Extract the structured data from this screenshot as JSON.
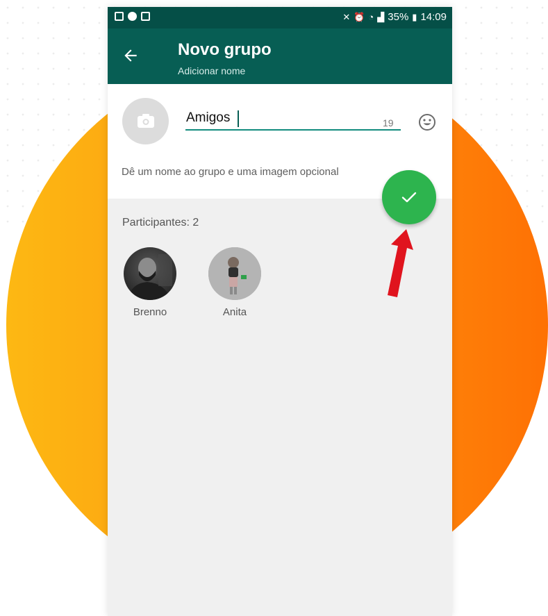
{
  "status_bar": {
    "left_icons": [
      "gallery-icon",
      "spotify-icon",
      "checkbox-icon"
    ],
    "right_icons": [
      "mute-icon",
      "alarm-icon",
      "wifi-icon",
      "signal-icon"
    ],
    "battery": "35%",
    "time": "14:09"
  },
  "header": {
    "back_icon": "arrow-left-icon",
    "title": "Novo grupo",
    "subtitle": "Adicionar nome"
  },
  "group_form": {
    "photo_icon": "camera-icon",
    "name_value": "Amigos",
    "remaining_chars": "19",
    "emoji_icon": "smiley-icon",
    "hint": "Dê um nome ao grupo e uma imagem opcional"
  },
  "confirm_button": {
    "icon": "check-icon"
  },
  "participants": {
    "label": "Participantes: 2",
    "members": [
      {
        "name": "Brenno"
      },
      {
        "name": "Anita"
      }
    ]
  },
  "colors": {
    "header_green": "#075e54",
    "status_green": "#054f47",
    "fab_green": "#2db44e",
    "accent_teal": "#128c7e",
    "annotation_arrow": "#e0141e",
    "bg_circle_left": "#fdb813",
    "bg_circle_right": "#fe7104"
  }
}
